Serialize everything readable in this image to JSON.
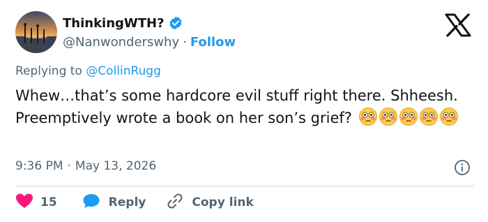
{
  "author": {
    "display_name": "ThinkingWTH?",
    "handle": "@Nanwonderswhy",
    "separator": "·",
    "follow_label": "Follow"
  },
  "reply_context": {
    "prefix": "Replying to",
    "mention": "@CollinRugg"
  },
  "tweet": {
    "text": "Whew…that’s some hardcore evil stuff right there. Shheesh.  Preemptively wrote a book on her son’s grief?",
    "emoji_count": 5,
    "emoji_name": "flushed-face"
  },
  "meta": {
    "time": "9:36 PM",
    "separator": "·",
    "date": "May 13, 2026"
  },
  "actions": {
    "like_count": "15",
    "reply_label": "Reply",
    "copy_label": "Copy link"
  },
  "colors": {
    "accent": "#1d9bf0",
    "like": "#f91880",
    "muted": "#536471",
    "text": "#0f1419",
    "divider": "#cfd9de"
  }
}
